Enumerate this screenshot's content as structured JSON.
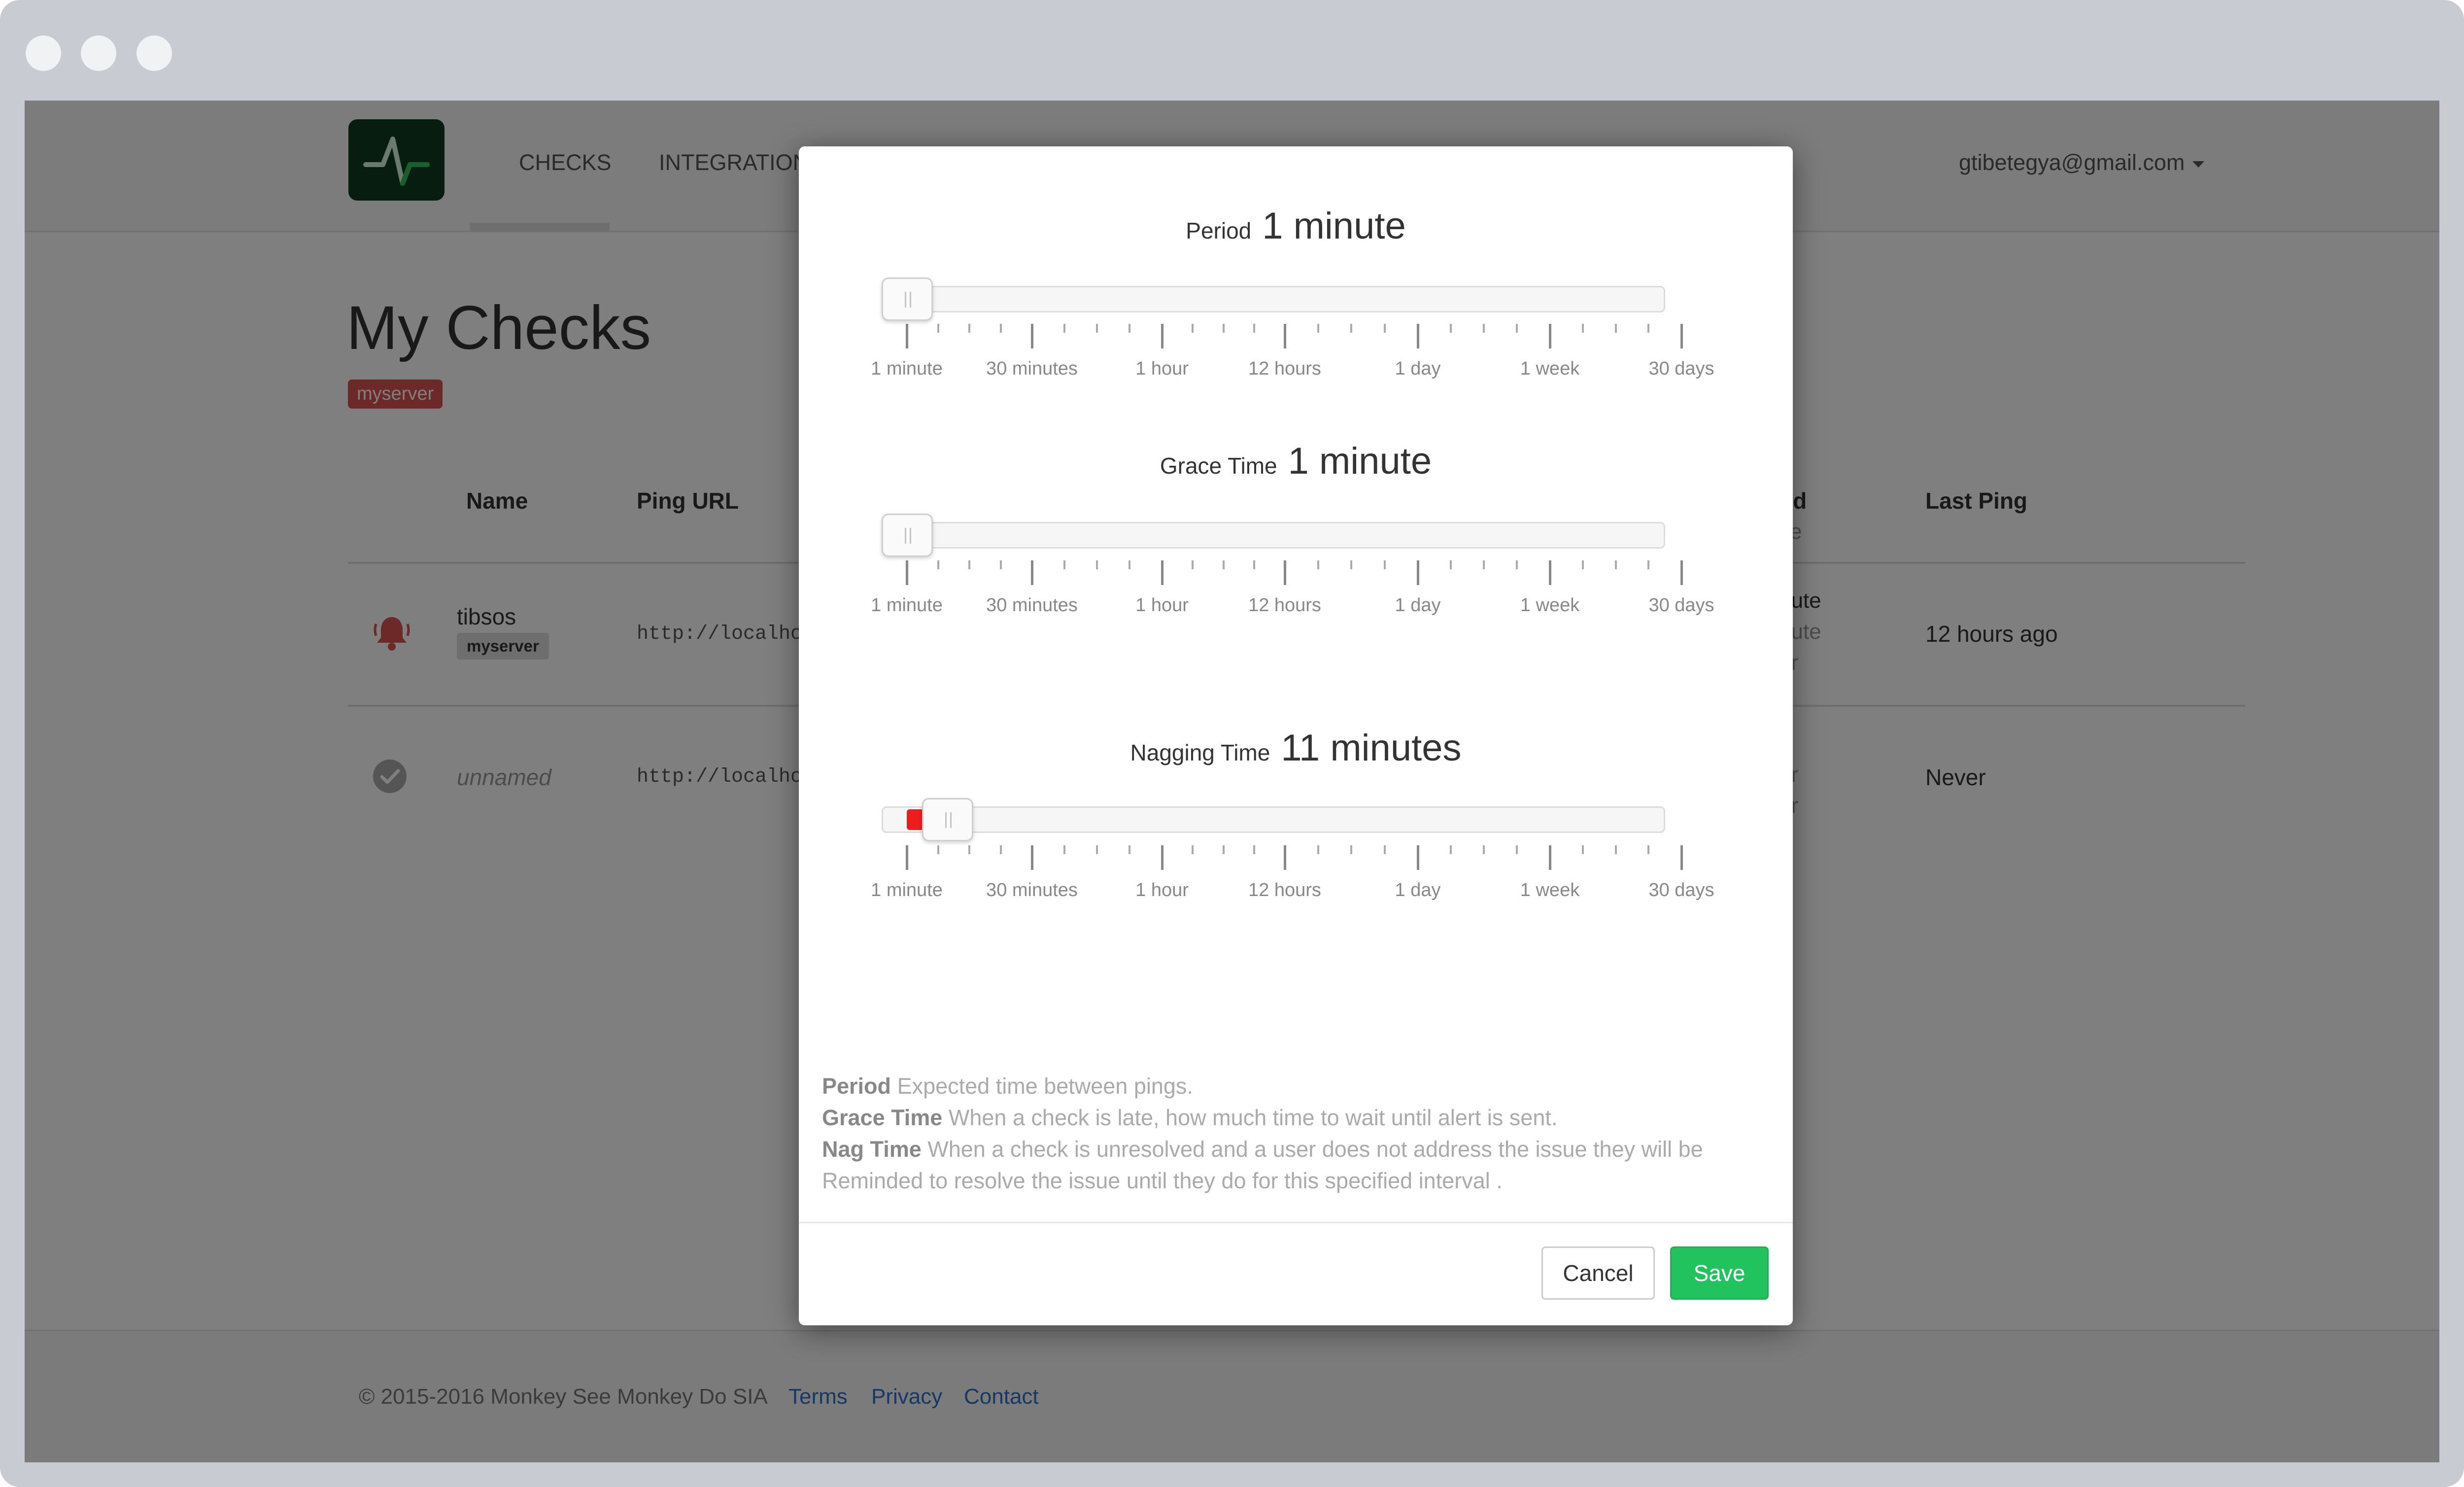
{
  "nav": {
    "links": [
      "CHECKS",
      "INTEGRATIONS"
    ],
    "user": "gtibetegya@gmail.com"
  },
  "page": {
    "title": "My Checks",
    "tag": "myserver"
  },
  "table": {
    "headers": {
      "name": "Name",
      "ping_url": "Ping URL",
      "period_partial": "od",
      "period_sub_partial": "ce",
      "last_ping": "Last Ping"
    },
    "rows": [
      {
        "status_icon": "bell-alert-icon",
        "name": "tibsos",
        "tag": "myserver",
        "url_partial": "http://localho",
        "period_partial": [
          "nute",
          "nute",
          "ur"
        ],
        "last_ping": "12 hours ago"
      },
      {
        "status_icon": "check-circle-icon",
        "name": "unnamed",
        "url_partial": "http://localho",
        "period_partial": [
          "y",
          "ur",
          "ur"
        ],
        "last_ping": "Never"
      }
    ]
  },
  "footer": {
    "copyright": "© 2015-2016 Monkey See Monkey Do SIA",
    "links": [
      "Terms",
      "Privacy",
      "Contact"
    ]
  },
  "modal": {
    "tick_labels": [
      "1 minute",
      "30 minutes",
      "1 hour",
      "12 hours",
      "1 day",
      "1 week",
      "30 days"
    ],
    "sliders": [
      {
        "label": "Period",
        "value": "1 minute",
        "position_fraction": 0.0,
        "fill_color": null
      },
      {
        "label": "Grace Time",
        "value": "1 minute",
        "position_fraction": 0.0,
        "fill_color": null
      },
      {
        "label": "Nagging Time",
        "value": "11 minutes",
        "position_fraction": 0.055,
        "fill_color": "#ee1c1c"
      }
    ],
    "help": [
      {
        "term": "Period",
        "text": "Expected time between pings."
      },
      {
        "term": "Grace Time",
        "text": "When a check is late, how much time to wait until alert is sent."
      },
      {
        "term": "Nag Time",
        "text": "When a check is unresolved and a user does not address the issue they will be Reminded to resolve the issue until they do for this specified interval ."
      }
    ],
    "buttons": {
      "cancel": "Cancel",
      "save": "Save"
    }
  },
  "colors": {
    "logo_bg": "#0c3b20",
    "alert": "#d9534f",
    "save_button": "#22c35e",
    "link": "#2a72c9"
  }
}
